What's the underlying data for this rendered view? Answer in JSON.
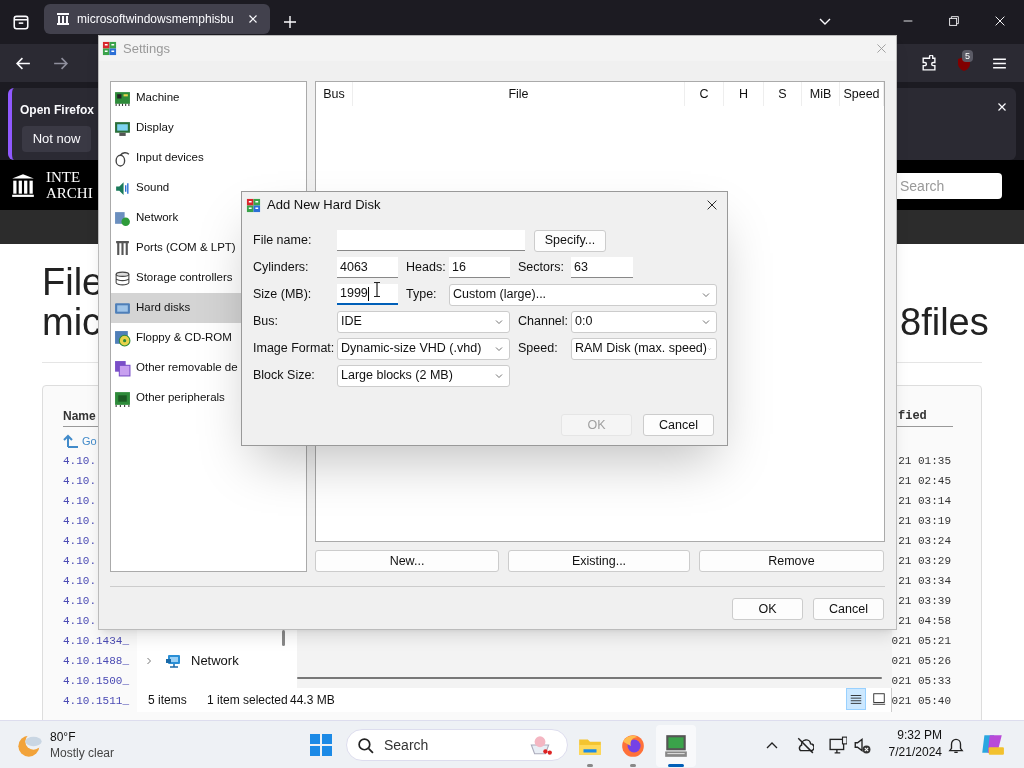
{
  "browser": {
    "tab_title": "microsoftwindowsmemphisbu",
    "extension_badge": "5",
    "notification": {
      "title": "Open Firefox",
      "button": "Not now"
    }
  },
  "site": {
    "logo_lines": [
      "INTE",
      "ARCHI"
    ],
    "search": {
      "placeholder": "Search"
    },
    "heading_lines": [
      "File",
      "mic"
    ],
    "heading_end": "8files",
    "listing": {
      "columns": [
        "Name",
        "fied"
      ],
      "parent_link": "Go",
      "rows": [
        {
          "name": "4.10.",
          "date": "21 01:35"
        },
        {
          "name": "4.10.",
          "date": "21 02:45"
        },
        {
          "name": "4.10.",
          "date": "21 03:14"
        },
        {
          "name": "4.10.",
          "date": "21 03:19"
        },
        {
          "name": "4.10.",
          "date": "21 03:24"
        },
        {
          "name": "4.10.",
          "date": "21 03:29"
        },
        {
          "name": "4.10.",
          "date": "21 03:34"
        },
        {
          "name": "4.10.",
          "date": "21 03:39"
        },
        {
          "name": "4.10.",
          "date": "21 04:58"
        },
        {
          "name": "4.10.1434_",
          "date": "021 05:21"
        },
        {
          "name": "4.10.1488_",
          "date": "021 05:26"
        },
        {
          "name": "4.10.1500_",
          "date": "021 05:33"
        },
        {
          "name": "4.10.1511_",
          "date": "021 05:40"
        }
      ]
    }
  },
  "explorer": {
    "tree": [
      {
        "label": "Network",
        "expanded": false
      }
    ],
    "status": {
      "count": "5 items",
      "selection": "1 item selected",
      "size": "44.3 MB"
    },
    "views": [
      {
        "kind": "details",
        "selected": true
      },
      {
        "kind": "tiles",
        "selected": false
      }
    ]
  },
  "settings": {
    "title": "Settings",
    "categories": [
      {
        "label": "Machine",
        "selected": false
      },
      {
        "label": "Display",
        "selected": false
      },
      {
        "label": "Input devices",
        "selected": false
      },
      {
        "label": "Sound",
        "selected": false
      },
      {
        "label": "Network",
        "selected": false
      },
      {
        "label": "Ports (COM & LPT)",
        "selected": false
      },
      {
        "label": "Storage controllers",
        "selected": false
      },
      {
        "label": "Hard disks",
        "selected": true
      },
      {
        "label": "Floppy & CD-ROM",
        "selected": false
      },
      {
        "label": "Other removable de",
        "selected": false
      },
      {
        "label": "Other peripherals",
        "selected": false
      }
    ],
    "columns": [
      "Bus",
      "File",
      "C",
      "H",
      "S",
      "MiB",
      "Speed"
    ],
    "disk_buttons": [
      "New...",
      "Existing...",
      "Remove"
    ],
    "buttons": [
      "OK",
      "Cancel"
    ]
  },
  "dialog": {
    "title": "Add New Hard Disk",
    "specify_button": "Specify...",
    "fields": [
      {
        "label": "File name:",
        "kind": "text",
        "focused": false
      },
      {
        "label": "Cylinders:",
        "kind": "text",
        "value": "4063",
        "focused": false
      },
      {
        "label": "Heads:",
        "kind": "text",
        "value": "16",
        "focused": false
      },
      {
        "label": "Sectors:",
        "kind": "text",
        "value": "63",
        "focused": false
      },
      {
        "label": "Size (MB):",
        "kind": "text",
        "value": "1999",
        "focused": true
      },
      {
        "label": "Type:",
        "kind": "select",
        "value": "Custom (large)..."
      },
      {
        "label": "Bus:",
        "kind": "select",
        "value": "IDE"
      },
      {
        "label": "Channel:",
        "kind": "select",
        "value": "0:0"
      },
      {
        "label": "Image Format:",
        "kind": "select",
        "value": "Dynamic-size VHD (.vhd)"
      },
      {
        "label": "Speed:",
        "kind": "select",
        "value": "RAM Disk (max. speed)"
      },
      {
        "label": "Block Size:",
        "kind": "select",
        "value": "Large blocks (2 MB)"
      }
    ],
    "buttons": [
      {
        "label": "OK",
        "disabled": true
      },
      {
        "label": "Cancel",
        "disabled": false
      }
    ]
  },
  "taskbar": {
    "weather": {
      "temperature": "80°F",
      "condition": "Mostly clear"
    },
    "search": {
      "label": "Search"
    },
    "apps": [
      {
        "kind": "files",
        "active": false
      },
      {
        "kind": "browser",
        "active": false
      },
      {
        "kind": "emulator",
        "active": true
      }
    ],
    "clock": {
      "time": "9:32 PM",
      "date": "7/21/2024"
    }
  }
}
